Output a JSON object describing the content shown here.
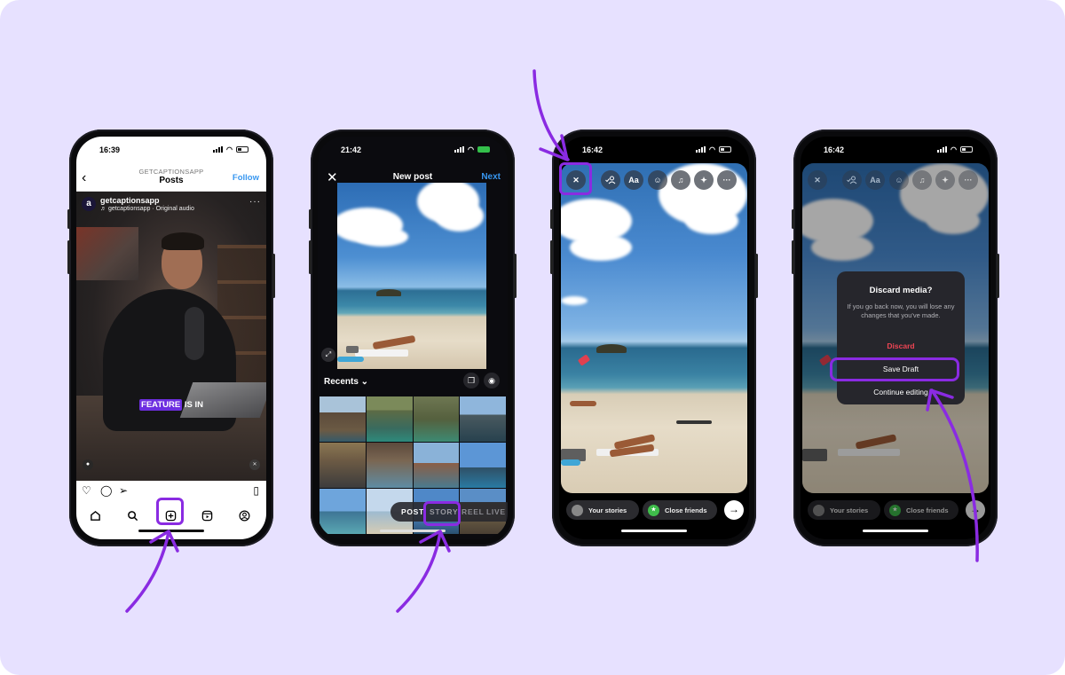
{
  "colors": {
    "background": "#E7E1FF",
    "highlight": "#8A2BE2",
    "instagram_blue": "#3897F0",
    "discard_red": "#EF4554",
    "caption_highlight": "#6D2EE0"
  },
  "phone1": {
    "status": {
      "time": "16:39"
    },
    "nav": {
      "back_icon": "chevron-left-icon",
      "subtitle": "GETCAPTIONSAPP",
      "title": "Posts",
      "follow": "Follow"
    },
    "post": {
      "avatar_letter": "a",
      "username": "getcaptionsapp",
      "audio": "♬ getcaptionsapp · Original audio",
      "more": "···",
      "caption_highlight": "FEATURE",
      "caption_rest": " IS IN"
    },
    "actions": [
      "heart-icon",
      "comment-icon",
      "share-icon",
      "bookmark-icon"
    ],
    "tabbar": [
      "home-icon",
      "search-icon",
      "create-icon",
      "reels-icon",
      "profile-icon"
    ]
  },
  "phone2": {
    "status": {
      "time": "21:42"
    },
    "header": {
      "close": "✕",
      "title": "New post",
      "next": "Next"
    },
    "gallery": {
      "label": "Recents ⌄"
    },
    "modes": [
      "POST",
      "STORY",
      "REEL",
      "LIVE"
    ],
    "selected_mode_highlighted": "STORY"
  },
  "phone3": {
    "status": {
      "time": "16:42"
    },
    "tools": [
      "close-icon",
      "tag-people-icon",
      "text-icon",
      "sticker-icon",
      "music-icon",
      "effects-icon",
      "more-icon"
    ],
    "tool_labels": {
      "close": "✕",
      "text": "Aa",
      "more": "···"
    },
    "share": {
      "your_stories": "Your stories",
      "close_friends": "Close friends",
      "next": "→"
    }
  },
  "phone4": {
    "status": {
      "time": "16:42"
    },
    "dialog": {
      "title": "Discard media?",
      "message": "If you go back now, you will lose any changes that you've made.",
      "discard": "Discard",
      "save_draft": "Save Draft",
      "continue": "Continue editing"
    },
    "share": {
      "your_stories": "Your stories",
      "close_friends": "Close friends",
      "next": "→"
    }
  }
}
